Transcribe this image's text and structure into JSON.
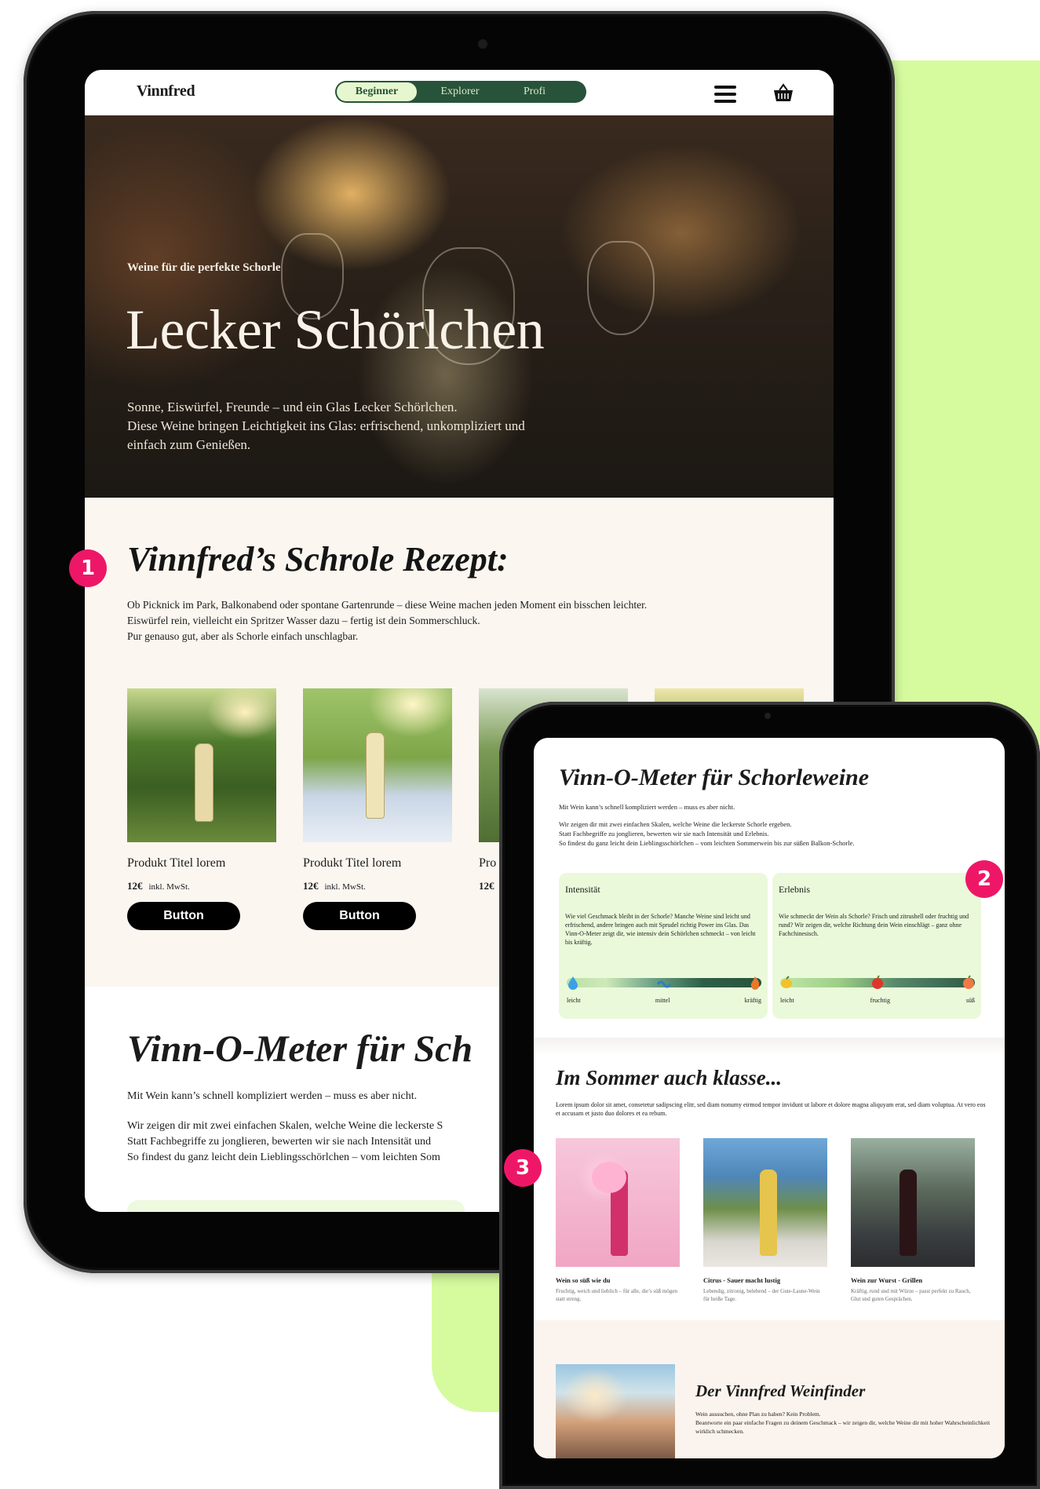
{
  "navbar": {
    "logo": "Vinnfred",
    "levels": [
      "Beginner",
      "Explorer",
      "Profi"
    ],
    "active_level": "Beginner",
    "menu_icon": "hamburger-menu-icon",
    "cart_icon": "shopping-basket-icon"
  },
  "hero": {
    "eyebrow": "Weine für die perfekte Schorle",
    "title": "Lecker Schörlchen",
    "text_lines": [
      "Sonne, Eiswürfel, Freunde – und ein Glas Lecker Schörlchen.",
      "Diese Weine bringen Leichtigkeit ins Glas: erfrischend, unkompliziert und",
      "einfach zum Genießen."
    ]
  },
  "recipe": {
    "title": "Vinnfred’s Schrole Rezept:",
    "text_lines": [
      "Ob Picknick im Park, Balkonabend oder spontane Gartenrunde – diese Weine machen jeden Moment ein bisschen leichter.",
      "Eiswürfel rein, vielleicht ein Spritzer Wasser dazu – fertig ist dein Sommerschluck.",
      "Pur genauso gut, aber als Schorle einfach unschlagbar."
    ]
  },
  "products": [
    {
      "title": "Produkt Titel lorem",
      "price": "12€",
      "tax": "inkl. MwSt.",
      "button": "Button"
    },
    {
      "title": "Produkt Titel lorem",
      "price": "12€",
      "tax": "inkl. MwSt.",
      "button": "Button"
    },
    {
      "title": "Pro",
      "price": "12€",
      "tax": "",
      "button": ""
    }
  ],
  "meter_big": {
    "title": "Vinn-O-Meter für Sch",
    "intro": "Mit Wein kann’s schnell kompliziert werden – muss es aber nicht.",
    "text_lines": [
      "Wir zeigen dir mit zwei einfachen Skalen, welche Weine die leckerste S",
      "Statt Fachbegriffe zu jonglieren, bewerten wir sie nach Intensität und",
      "So findest du ganz leicht dein Lieblingsschörlchen – vom leichten Som"
    ]
  },
  "meter": {
    "title": "Vinn-O-Meter für Schorleweine",
    "intro": "Mit Wein kann’s schnell kompliziert werden – muss es aber nicht.",
    "text_lines": [
      "Wir zeigen dir mit zwei einfachen Skalen, welche Weine die leckerste Schorle ergeben.",
      "Statt Fachbegriffe zu jonglieren, bewerten wir sie nach Intensität und Erlebnis.",
      "So findest du ganz leicht dein Lieblingsschörlchen – vom leichten Sommerwein bis zur süßen Balkon-Schorle."
    ],
    "cards": [
      {
        "title": "Intensität",
        "text": "Wie viel Geschmack bleibt in der Schorle? Manche Weine sind leicht und erfrischend, andere bringen auch mit Sprudel richtig Power ins Glas. Das Vinn-O-Meter zeigt dir, wie intensiv dein Schörlchen schmeckt – von leicht bis kräftig.",
        "labels": [
          "leicht",
          "mittel",
          "kräftig"
        ],
        "icons": [
          "water-drop-icon",
          "wave-icon",
          "flame-icon"
        ]
      },
      {
        "title": "Erlebnis",
        "text": "Wie schmeckt der Wein als Schorle? Frisch und zitrushell oder fruchtig und rund? Wir zeigen dir, welche Richtung dein Wein einschlägt – ganz ohne Fachchinesisch.",
        "labels": [
          "leicht",
          "fruchtig",
          "süß"
        ],
        "icons": [
          "lemon-icon",
          "apple-icon",
          "peach-icon"
        ]
      }
    ]
  },
  "summer": {
    "title": "Im Sommer auch klasse...",
    "text": "Lorem ipsum dolor sit amet, consetetur sadipscing elitr, sed diam nonumy eirmod tempor invidunt ut labore et dolore magna aliquyam erat, sed diam voluptua. At vero eos et accusam et justo duo dolores et ea rebum.",
    "items": [
      {
        "title": "Wein so süß wie du",
        "desc": "Fruchtig, weich und lieblich – für alle, die’s süß mögen statt streng."
      },
      {
        "title": "Citrus - Sauer macht lustig",
        "desc": "Lebendig, zitronig, belebend – der Gute-Laune-Wein für heiße Tage."
      },
      {
        "title": "Wein zur Wurst - Grillen",
        "desc": "Kräftig, rund und mit Würze – passt perfekt zu Rauch, Glut und guten Gesprächen."
      }
    ]
  },
  "finder": {
    "title": "Der Vinnfred Weinfinder",
    "text_lines": [
      "Wein aussuchen, ohne Plan zu haben? Kein Problem.",
      "Beantworte ein paar einfache Fragen zu deinem Geschmack – wir zeigen dir, welche Weine dir mit hoher Wahrscheinlichkeit wirklich schmecken."
    ]
  },
  "badges": [
    "1",
    "2",
    "3"
  ],
  "colors": {
    "accent_green": "#27533a",
    "backdrop": "#d6fb9f",
    "badge": "#ee1767",
    "card": "#eaf9da"
  }
}
